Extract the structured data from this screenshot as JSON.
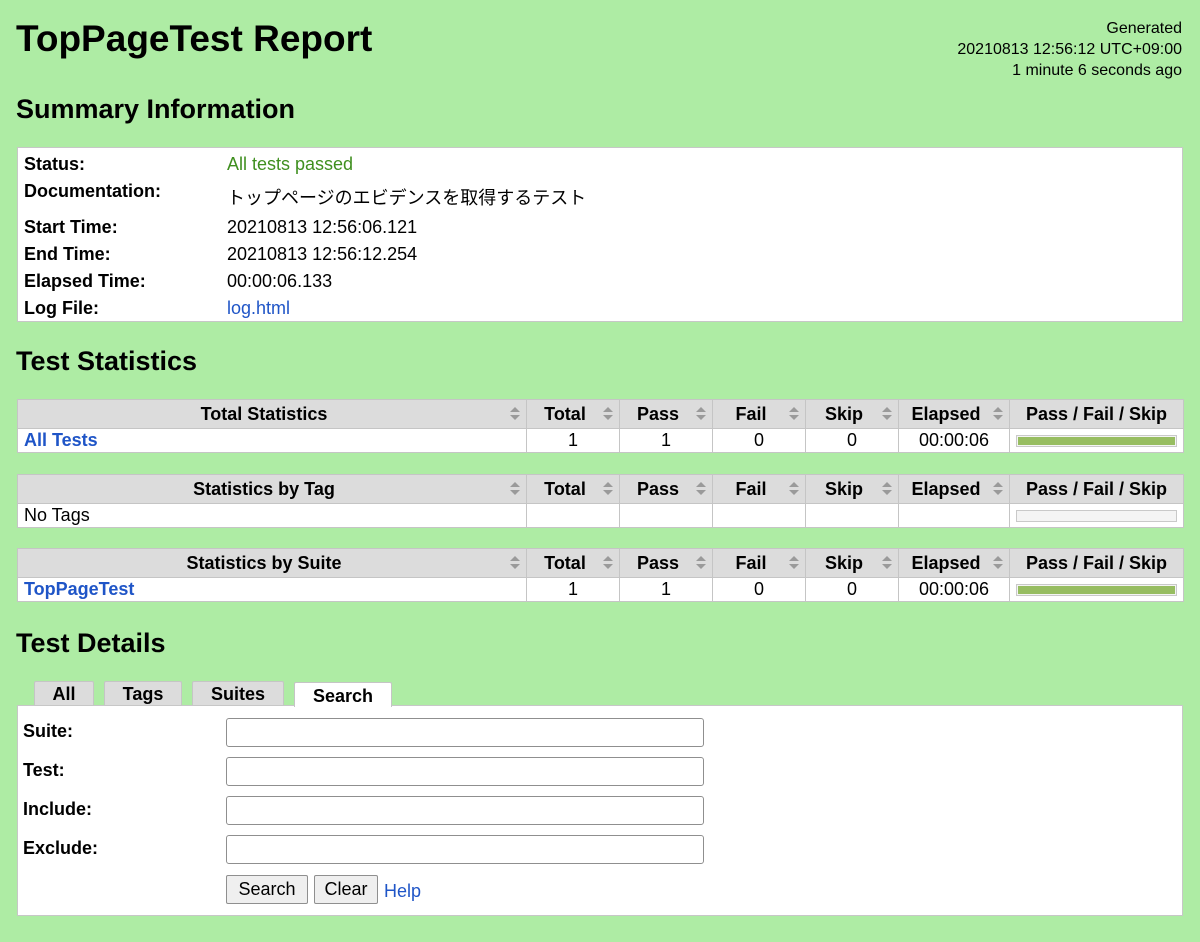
{
  "title": "TopPageTest Report",
  "generated": {
    "label": "Generated",
    "datetime": "20210813 12:56:12 UTC+09:00",
    "relative": "1 minute 6 seconds ago"
  },
  "sections": {
    "summary": "Summary Information",
    "statistics": "Test Statistics",
    "details": "Test Details"
  },
  "summary": {
    "status_label": "Status:",
    "status_value": "All tests passed",
    "documentation_label": "Documentation:",
    "documentation_value": "トップページのエビデンスを取得するテスト",
    "start_label": "Start Time:",
    "start_value": "20210813 12:56:06.121",
    "end_label": "End Time:",
    "end_value": "20210813 12:56:12.254",
    "elapsed_label": "Elapsed Time:",
    "elapsed_value": "00:00:06.133",
    "log_label": "Log File:",
    "log_value": "log.html"
  },
  "columns": {
    "total": "Total",
    "pass": "Pass",
    "fail": "Fail",
    "skip": "Skip",
    "elapsed": "Elapsed",
    "graph": "Pass / Fail / Skip"
  },
  "total_stats": {
    "header": "Total Statistics",
    "rows": [
      {
        "name": "All Tests",
        "total": "1",
        "pass": "1",
        "fail": "0",
        "skip": "0",
        "elapsed": "00:00:06",
        "pass_ratio": 1.0
      }
    ]
  },
  "tag_stats": {
    "header": "Statistics by Tag",
    "empty_label": "No Tags"
  },
  "suite_stats": {
    "header": "Statistics by Suite",
    "rows": [
      {
        "name": "TopPageTest",
        "total": "1",
        "pass": "1",
        "fail": "0",
        "skip": "0",
        "elapsed": "00:00:06",
        "pass_ratio": 1.0
      }
    ]
  },
  "tabs": {
    "all": "All",
    "tags": "Tags",
    "suites": "Suites",
    "search": "Search",
    "active": "search"
  },
  "search": {
    "suite_label": "Suite:",
    "test_label": "Test:",
    "include_label": "Include:",
    "exclude_label": "Exclude:",
    "suite_value": "",
    "test_value": "",
    "include_value": "",
    "exclude_value": "",
    "search_button": "Search",
    "clear_button": "Clear",
    "help_link": "Help"
  },
  "colors": {
    "background": "#aeeca4",
    "pass_text": "#3f8f1f",
    "link": "#1f55c7",
    "pass_bar": "#97bd61"
  }
}
